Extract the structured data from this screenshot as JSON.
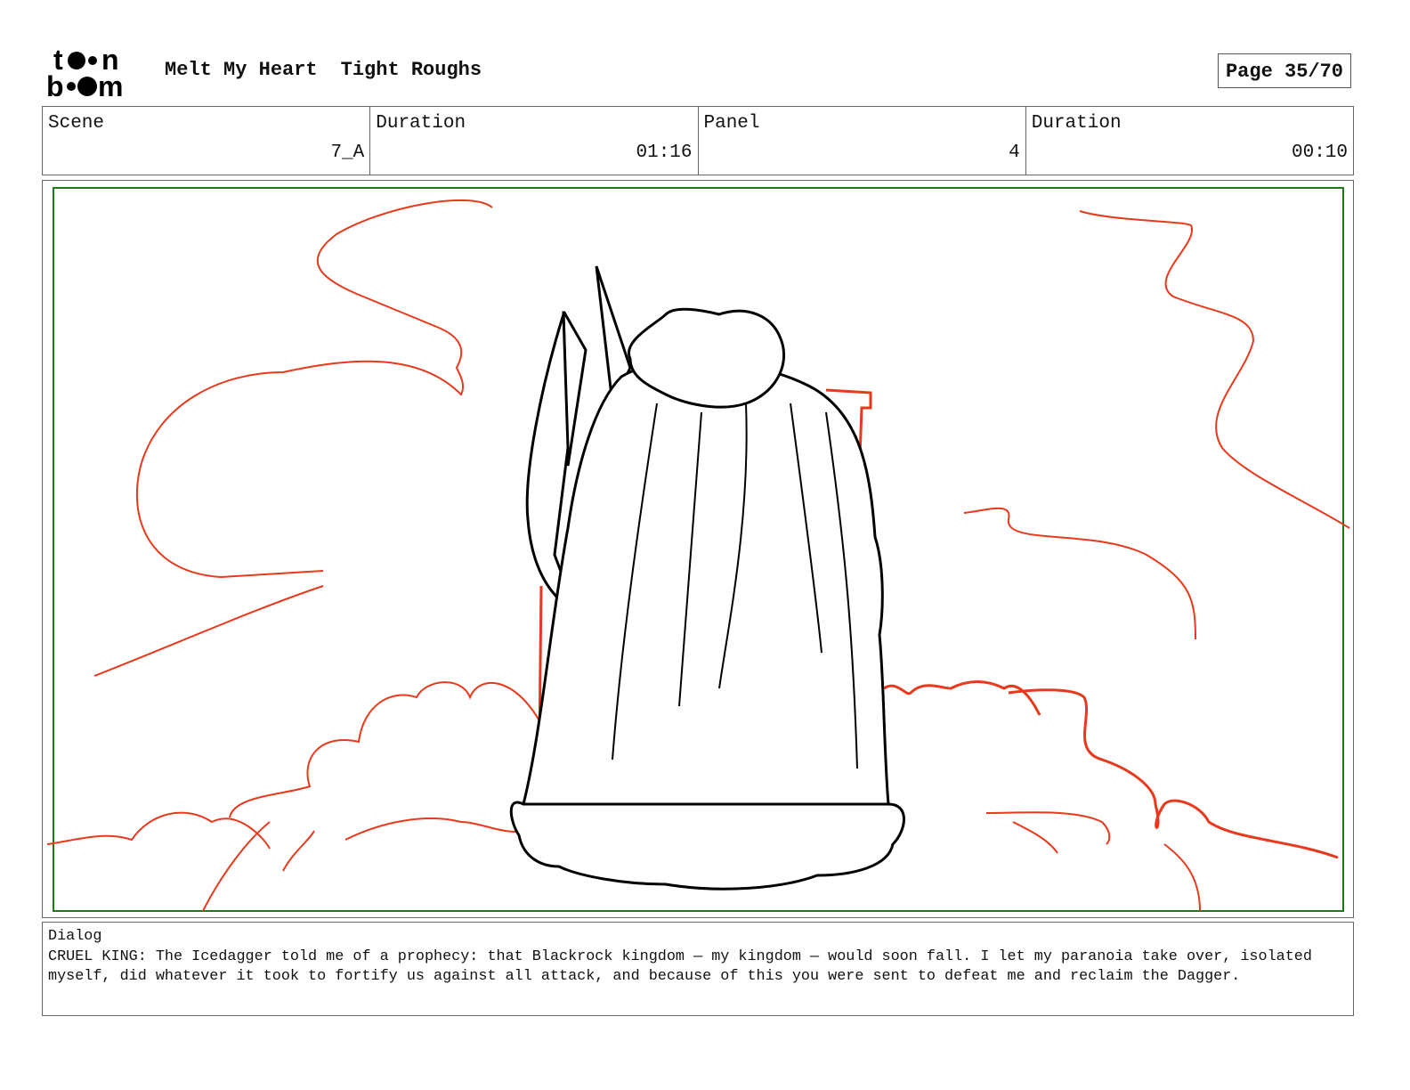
{
  "logo": {
    "text": "toon boom"
  },
  "header": {
    "project": "Melt My Heart",
    "stage": "Tight Roughs",
    "page": "Page 35/70"
  },
  "info": [
    {
      "label": "Scene",
      "value": "7_A"
    },
    {
      "label": "Duration",
      "value": "01:16"
    },
    {
      "label": "Panel",
      "value": "4"
    },
    {
      "label": "Duration",
      "value": "00:10"
    }
  ],
  "colors": {
    "frame": "#1a7a1a",
    "sketch_red": "#e8391c",
    "ink": "#000000"
  },
  "dialog": {
    "label": "Dialog",
    "text": "CRUEL KING: The Icedagger told me of a prophecy: that Blackrock kingdom — my kingdom — would soon fall. I let my paranoia take over, isolated myself, did whatever it took to fortify us against all attack, and because of this you were sent to defeat me and reclaim the Dagger."
  }
}
